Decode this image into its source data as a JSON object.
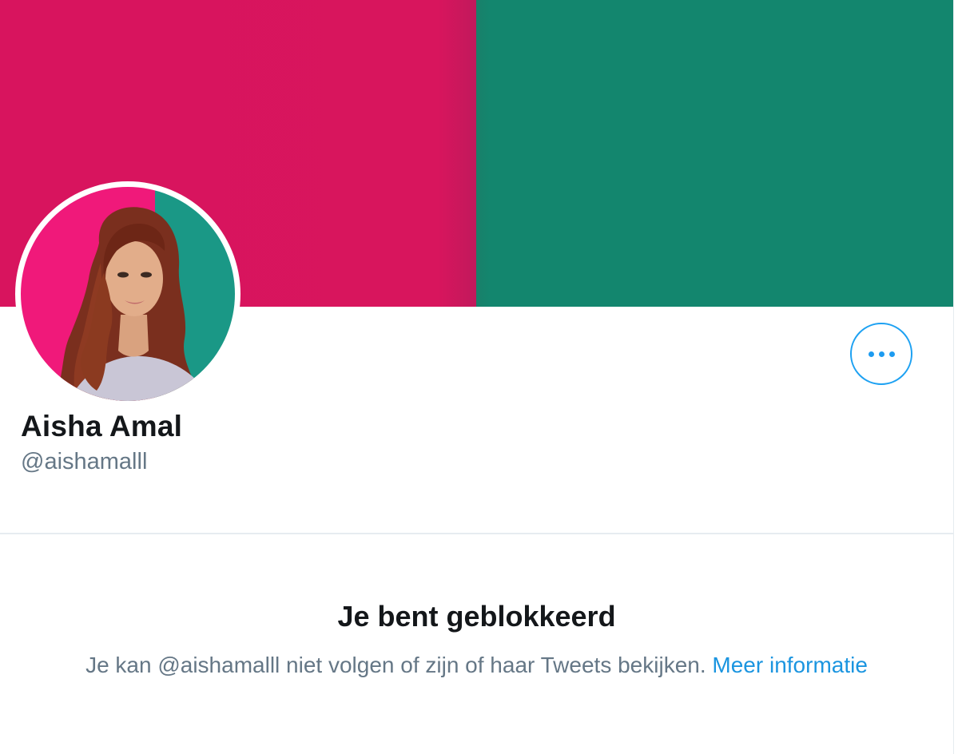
{
  "profile": {
    "display_name": "Aisha Amal",
    "handle": "@aishamalll"
  },
  "actions": {
    "more_icon": "more-horizontal-icon"
  },
  "blocked": {
    "title": "Je bent geblokkeerd",
    "message": "Je kan @aishamalll niet volgen of zijn of haar Tweets bekijken.",
    "learn_more": "Meer informatie"
  },
  "colors": {
    "banner_left": "#d8155d",
    "banner_right": "#13866e",
    "accent": "#1da1f2",
    "text_primary": "#14171a",
    "text_secondary": "#657786"
  }
}
